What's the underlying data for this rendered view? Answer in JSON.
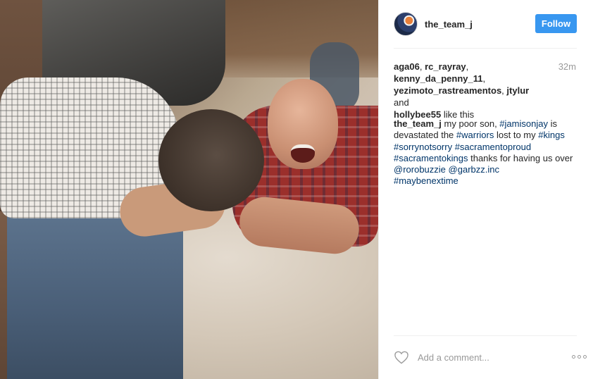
{
  "post": {
    "username": "the_team_j",
    "follow_label": "Follow",
    "timestamp": "32m",
    "likes": {
      "names": [
        "aga06",
        "rc_rayray",
        "kenny_da_penny_11",
        "yezimoto_rastreamentos",
        "jtylur",
        "hollybee55"
      ],
      "sep1": ", ",
      "sep2": ",",
      "sep3": ", ",
      "and_word": " and ",
      "suffix": " like this"
    },
    "caption": {
      "author": "the_team_j",
      "t1": " my poor son, ",
      "tag1": "#jamisonjay",
      "t2": " is devastated the ",
      "tag2": "#warriors",
      "t3": " lost to my ",
      "tag3": "#kings",
      "tag4": "#sorrynotsorry",
      "tag5": "#sacramentoproud",
      "tag6": "#sacramentokings",
      "t4": " thanks for having us over ",
      "tag7": "@rorobuzzie",
      "tag8": "@garbzz.inc",
      "tag9": "#maybenextime"
    },
    "comment_placeholder": "Add a comment...",
    "icons": {
      "avatar": "profile-avatar",
      "heart": "heart-icon",
      "more": "more-options-icon"
    },
    "colors": {
      "follow_button": "#3897f0",
      "hashtag": "#003569",
      "muted": "#999999"
    }
  }
}
